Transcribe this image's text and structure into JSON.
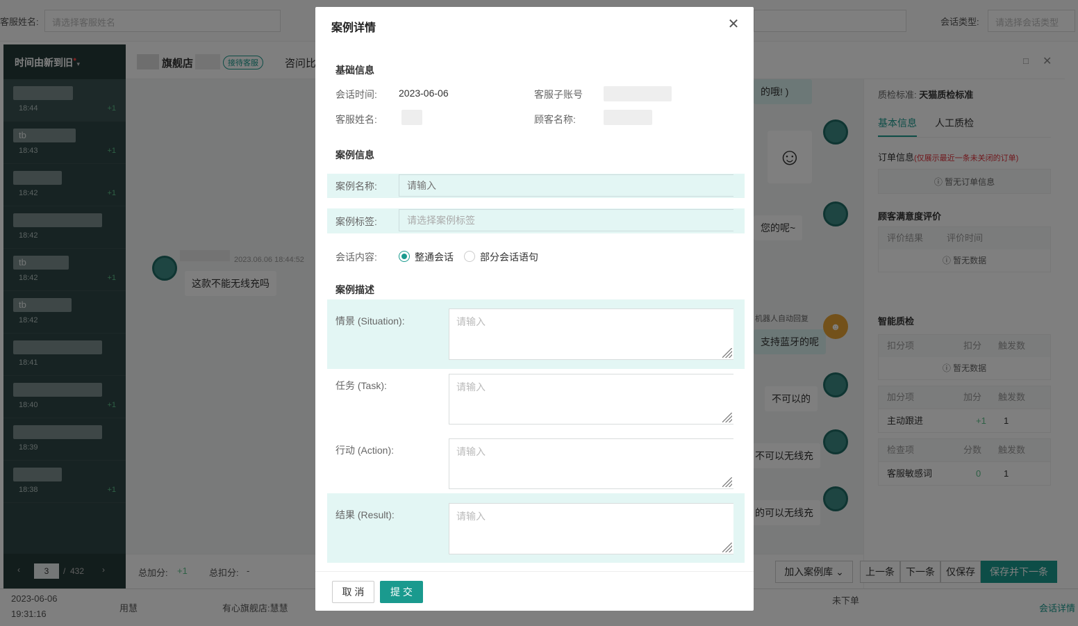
{
  "colors": {
    "accent": "#1a9a8e",
    "overlay": "rgba(0,0,0,0.5)",
    "sidebar": "#2f4746",
    "plus": "#5cc08a",
    "red_note": "#e0303a"
  },
  "filterbar": {
    "agent_label": "客服姓名:",
    "agent_placeholder": "请选择客服姓名",
    "session_type_label": "会话类型:",
    "session_type_placeholder": "请选择会话类型"
  },
  "sidebar": {
    "sort_label": "时间由新到旧",
    "conversations": [
      {
        "name": "",
        "time": "18:44",
        "plus": "+1"
      },
      {
        "name": "tb",
        "time": "18:43",
        "plus": "+1"
      },
      {
        "name": "",
        "time": "18:42",
        "plus": "+1"
      },
      {
        "name": "",
        "time": "18:42",
        "plus": ""
      },
      {
        "name": "tb",
        "time": "18:42",
        "plus": "+1"
      },
      {
        "name": "tb",
        "time": "18:42",
        "plus": ""
      },
      {
        "name": "",
        "time": "18:41",
        "plus": ""
      },
      {
        "name": "",
        "time": "18:40",
        "plus": "+1"
      },
      {
        "name": "",
        "time": "18:39",
        "plus": ""
      },
      {
        "name": "",
        "time": "18:38",
        "plus": "+1"
      }
    ],
    "pager": {
      "prev": "‹",
      "page": "3",
      "sep": "/",
      "total": "432",
      "next": "›"
    }
  },
  "chat": {
    "header": {
      "store": "旗舰店",
      "tag": "接待客服",
      "tab2": "咨问比"
    },
    "messages": [
      {
        "time": "2023.06.06 18:44:52",
        "text": "这款不能无线充吗"
      }
    ],
    "right_bubbles": [
      "的哦! )",
      "您的呢~",
      "机器人自动回复",
      "支持蓝牙的呢",
      "不可以的",
      "不可以无线充",
      "的可以无线充"
    ],
    "totals": {
      "plus_label": "总加分:",
      "plus_value": "+1",
      "minus_label": "总扣分:",
      "minus_value": "-"
    }
  },
  "actions": {
    "add_case": "加入案例库",
    "prev": "上一条",
    "next": "下一条",
    "save": "仅保存",
    "save_next": "保存并下一条"
  },
  "right_panel": {
    "standard_label": "质检标准:",
    "standard_value": "天猫质检标准",
    "tabs": [
      "基本信息",
      "人工质检"
    ],
    "order_title": "订单信息",
    "order_note": "(仅展示最近一条未关闭的订单)",
    "no_order": "暂无订单信息",
    "satisfaction_title": "顾客满意度评价",
    "satisfaction_cols": [
      "评价结果",
      "评价时间"
    ],
    "empty": "暂无数据",
    "smart_title": "智能质检",
    "deduct_cols": [
      "扣分项",
      "扣分",
      "触发数"
    ],
    "bonus_cols": [
      "加分项",
      "加分",
      "触发数"
    ],
    "bonus_row": {
      "item": "主动跟进",
      "score": "+1",
      "count": "1"
    },
    "check_cols": [
      "检查项",
      "分数",
      "触发数"
    ],
    "check_row": {
      "item": "客服敏感词",
      "score": "0",
      "count": "1"
    }
  },
  "bottom_row": {
    "date": "2023-06-06",
    "time": "19:31:16",
    "name": "用慧",
    "store": "有心旗舰店:慧慧",
    "status": "未下单",
    "link": "会话详情"
  },
  "modal": {
    "title": "案例详情",
    "basic_title": "基础信息",
    "session_time_label": "会话时间:",
    "session_time_value": "2023-06-06",
    "sub_account_label": "客服子账号",
    "agent_name_label": "客服姓名:",
    "customer_name_label": "顾客名称:",
    "case_title": "案例信息",
    "case_name_label": "案例名称:",
    "case_name_placeholder": "请输入",
    "case_tag_label": "案例标签:",
    "case_tag_placeholder": "请选择案例标签",
    "content_label": "会话内容:",
    "radio_full": "整通会话",
    "radio_partial": "部分会话语句",
    "desc_title": "案例描述",
    "situation_label": "情景 (Situation):",
    "task_label": "任务 (Task):",
    "action_label": "行动 (Action):",
    "result_label": "结果 (Result):",
    "ta_placeholder": "请输入",
    "cancel": "取 消",
    "submit": "提 交"
  }
}
